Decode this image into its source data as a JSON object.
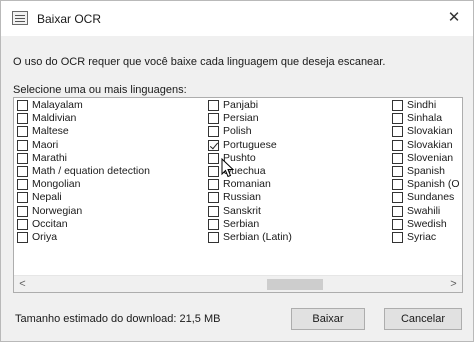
{
  "window": {
    "title": "Baixar OCR",
    "icon": "ocr-window-icon",
    "close_label": "✕"
  },
  "info_text": "O uso do OCR requer que você baixe cada linguagem que deseja escanear.",
  "select_label": "Selecione uma ou mais linguagens:",
  "languages": {
    "col1": [
      {
        "label": "Malayalam",
        "checked": false
      },
      {
        "label": "Maldivian",
        "checked": false
      },
      {
        "label": "Maltese",
        "checked": false
      },
      {
        "label": "Maori",
        "checked": false
      },
      {
        "label": "Marathi",
        "checked": false
      },
      {
        "label": "Math / equation detection",
        "checked": false
      },
      {
        "label": "Mongolian",
        "checked": false
      },
      {
        "label": "Nepali",
        "checked": false
      },
      {
        "label": "Norwegian",
        "checked": false
      },
      {
        "label": "Occitan",
        "checked": false
      },
      {
        "label": "Oriya",
        "checked": false
      }
    ],
    "col2": [
      {
        "label": "Panjabi",
        "checked": false
      },
      {
        "label": "Persian",
        "checked": false
      },
      {
        "label": "Polish",
        "checked": false
      },
      {
        "label": "Portuguese",
        "checked": true
      },
      {
        "label": "Pushto",
        "checked": false
      },
      {
        "label": "Quechua",
        "checked": false
      },
      {
        "label": "Romanian",
        "checked": false
      },
      {
        "label": "Russian",
        "checked": false
      },
      {
        "label": "Sanskrit",
        "checked": false
      },
      {
        "label": "Serbian",
        "checked": false
      },
      {
        "label": "Serbian (Latin)",
        "checked": false
      }
    ],
    "col3": [
      {
        "label": "Sindhi",
        "checked": false
      },
      {
        "label": "Sinhala",
        "checked": false
      },
      {
        "label": "Slovakian",
        "checked": false
      },
      {
        "label": "Slovakian",
        "checked": false
      },
      {
        "label": "Slovenian",
        "checked": false
      },
      {
        "label": "Spanish",
        "checked": false
      },
      {
        "label": "Spanish (O",
        "checked": false
      },
      {
        "label": "Sundanes",
        "checked": false
      },
      {
        "label": "Swahili",
        "checked": false
      },
      {
        "label": "Swedish",
        "checked": false
      },
      {
        "label": "Syriac",
        "checked": false
      }
    ]
  },
  "scrollbar": {
    "left_arrow": "<",
    "right_arrow": ">"
  },
  "download_size_text": "Tamanho estimado do download: 21,5 MB",
  "buttons": {
    "download": "Baixar",
    "cancel": "Cancelar"
  }
}
